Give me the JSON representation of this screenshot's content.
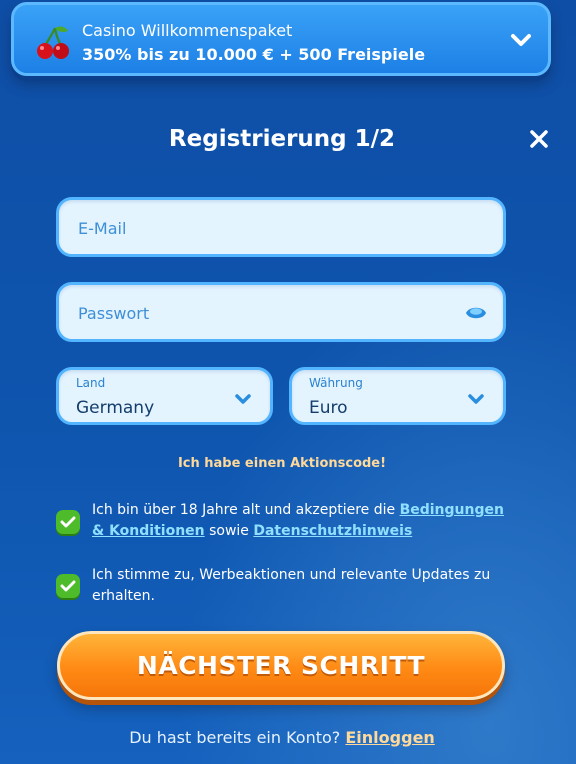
{
  "promo": {
    "icon": "cherry-icon",
    "title": "Casino Willkommenspaket",
    "subtitle": "350% bis zu 10.000 € + 500 Freispiele",
    "chevron_icon": "chevron-down-icon"
  },
  "header": {
    "title": "Registrierung 1/2",
    "close_icon": "close-icon"
  },
  "form": {
    "email": {
      "placeholder": "E-Mail",
      "value": ""
    },
    "password": {
      "placeholder": "Passwort",
      "value": "",
      "eye_icon": "eye-icon"
    },
    "country": {
      "label": "Land",
      "value": "Germany"
    },
    "currency": {
      "label": "Währung",
      "value": "Euro"
    }
  },
  "promo_code_link": "Ich habe einen Aktionscode!",
  "consents": {
    "terms": {
      "checked": true,
      "text_before": "Ich bin über 18 Jahre alt und akzeptiere die ",
      "link_terms": "Bedingungen & Konditionen",
      "text_middle": " sowie ",
      "link_privacy": "Datenschutzhinweis"
    },
    "marketing": {
      "checked": true,
      "text": "Ich stimme zu, Werbeaktionen und relevante Updates zu erhalten."
    }
  },
  "next_button": "NÄCHSTER SCHRITT",
  "login": {
    "prompt": "Du hast bereits ein Konto? ",
    "link": "Einloggen"
  },
  "colors": {
    "background": "#0e55ae",
    "field_border": "#53b4ff",
    "field_bg": "#e3f4ff",
    "checkbox": "#4dbb2a",
    "primary_button": "#ff8a14",
    "link_highlight": "#ffd99a",
    "link_blue": "#8fe0ff"
  }
}
